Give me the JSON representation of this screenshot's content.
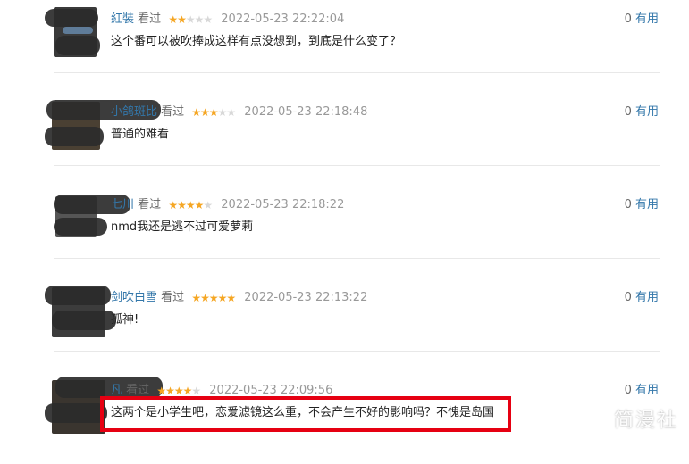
{
  "reviews": [
    {
      "user": "紅裝",
      "status": "看过",
      "rating": 2,
      "date": "2022-05-23 22:22:04",
      "useful_count": "0",
      "useful_label": "有用",
      "comment": "这个番可以被吹捧成这样有点没想到，到底是什么变了？"
    },
    {
      "user": "小鸽斑比",
      "status": "看过",
      "rating": 3,
      "date": "2022-05-23 22:18:48",
      "useful_count": "0",
      "useful_label": "有用",
      "comment": "普通的难看"
    },
    {
      "user": "七川",
      "status": "看过",
      "rating": 4,
      "date": "2022-05-23 22:18:22",
      "useful_count": "0",
      "useful_label": "有用",
      "comment": "nmd我还是逃不过可爱萝莉"
    },
    {
      "user": "剑吹白雪",
      "status": "看过",
      "rating": 5,
      "date": "2022-05-23 22:13:22",
      "useful_count": "0",
      "useful_label": "有用",
      "comment": "孤神!"
    },
    {
      "user": "凡",
      "status": "看过",
      "rating": 4,
      "date": "2022-05-23 22:09:56",
      "useful_count": "0",
      "useful_label": "有用",
      "comment": "这两个是小学生吧，恋爱滤镜这么重，不会产生不好的影响吗？不愧是岛国"
    }
  ],
  "watermark": "简漫社",
  "colors": {
    "star_on": "#f5a623",
    "star_off": "#d8d8d8",
    "link": "#3377aa",
    "highlight": "#e60012"
  }
}
